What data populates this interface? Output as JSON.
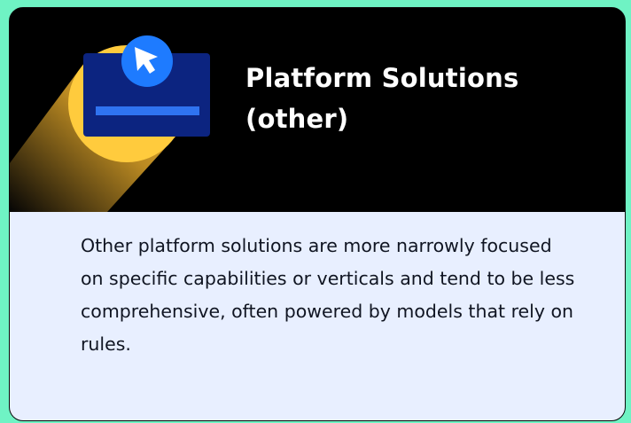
{
  "card": {
    "title_line_1": "Platform Solutions",
    "title_line_2": "(other)",
    "description": "Other platform solutions are more narrowly focused on specific capabilities or verticals and tend to be less comprehensive, often powered by models that rely on rules.",
    "illustration_icon": "platform-window-cursor-icon"
  },
  "colors": {
    "page_background": "#6ff3c4",
    "header_background": "#000000",
    "body_background": "#e8efff",
    "title_text": "#ffffff",
    "description_text": "#101522",
    "illustration_window": "#0c2480",
    "illustration_bar": "#2f73f0",
    "illustration_circle": "#ffcb3d",
    "illustration_cursor_badge": "#1e7bff",
    "illustration_cursor_badge_accent": "#7ff0cd"
  }
}
